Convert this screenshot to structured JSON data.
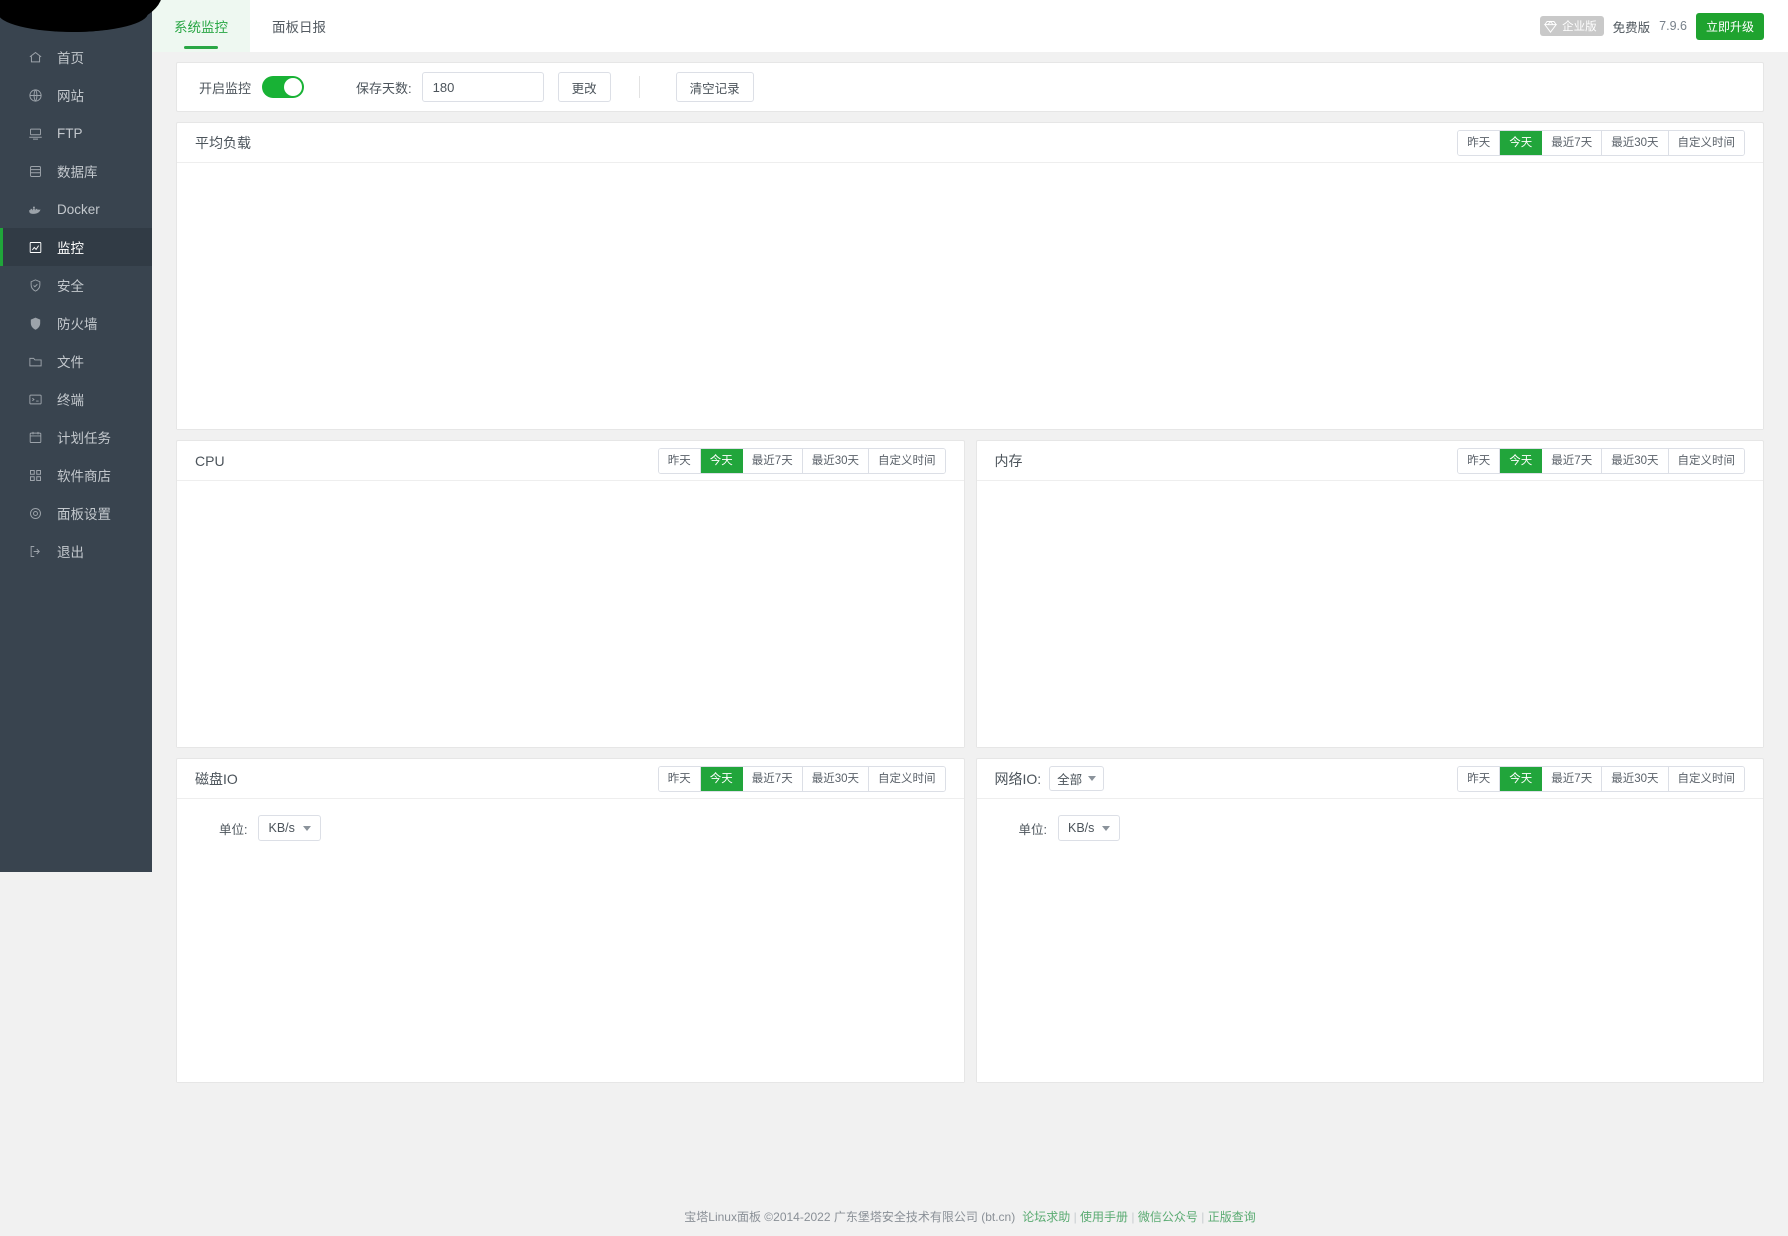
{
  "sidebar": {
    "items": [
      {
        "label": "首页",
        "icon": "home-icon",
        "active": false
      },
      {
        "label": "网站",
        "icon": "globe-icon",
        "active": false
      },
      {
        "label": "FTP",
        "icon": "ftp-icon",
        "active": false
      },
      {
        "label": "数据库",
        "icon": "database-icon",
        "active": false
      },
      {
        "label": "Docker",
        "icon": "docker-icon",
        "active": false
      },
      {
        "label": "监控",
        "icon": "monitor-icon",
        "active": true
      },
      {
        "label": "安全",
        "icon": "shield-check-icon",
        "active": false
      },
      {
        "label": "防火墙",
        "icon": "shield-solid-icon",
        "active": false
      },
      {
        "label": "文件",
        "icon": "folder-icon",
        "active": false
      },
      {
        "label": "终端",
        "icon": "terminal-icon",
        "active": false
      },
      {
        "label": "计划任务",
        "icon": "calendar-icon",
        "active": false
      },
      {
        "label": "软件商店",
        "icon": "grid-icon",
        "active": false
      },
      {
        "label": "面板设置",
        "icon": "gear-icon",
        "active": false
      },
      {
        "label": "退出",
        "icon": "logout-icon",
        "active": false
      }
    ]
  },
  "header": {
    "tabs": [
      {
        "label": "系统监控",
        "active": true
      },
      {
        "label": "面板日报",
        "active": false
      }
    ],
    "enterprise_badge": "企业版",
    "edition": "免费版",
    "version": "7.9.6",
    "upgrade_label": "立即升级"
  },
  "controls": {
    "monitor_toggle_label": "开启监控",
    "monitor_enabled": true,
    "save_days_label": "保存天数:",
    "save_days_value": "180",
    "save_days_placeholder": "保存天数",
    "change_label": "更改",
    "clear_records_label": "清空记录"
  },
  "range_buttons": [
    "昨天",
    "今天",
    "最近7天",
    "最近30天",
    "自定义时间"
  ],
  "active_range": "今天",
  "panels": {
    "load": {
      "title": "平均负载"
    },
    "cpu": {
      "title": "CPU"
    },
    "memory": {
      "title": "内存"
    },
    "disk_io": {
      "title": "磁盘IO",
      "unit_label": "单位:",
      "unit_value": "KB/s"
    },
    "network_io": {
      "title": "网络IO:",
      "interface_value": "全部",
      "unit_label": "单位:",
      "unit_value": "KB/s"
    }
  },
  "footer": {
    "copyright": "宝塔Linux面板 ©2014-2022 广东堡塔安全技术有限公司 (bt.cn)",
    "links": [
      "论坛求助",
      "使用手册",
      "微信公众号",
      "正版查询"
    ],
    "divider": "|"
  },
  "colors": {
    "accent_green": "#21a53b",
    "sidebar_bg": "#39444f",
    "sidebar_active_bg": "#313b45",
    "page_bg": "#f1f1f1"
  },
  "chart_data": [
    {
      "type": "line",
      "title": "平均负载",
      "series": [],
      "x": [],
      "note": "empty"
    },
    {
      "type": "line",
      "title": "CPU",
      "series": [],
      "x": [],
      "note": "empty"
    },
    {
      "type": "line",
      "title": "内存",
      "series": [],
      "x": [],
      "note": "empty"
    },
    {
      "type": "line",
      "title": "磁盘IO",
      "series": [],
      "x": [],
      "ylabel": "KB/s",
      "note": "empty"
    },
    {
      "type": "line",
      "title": "网络IO",
      "series": [],
      "x": [],
      "ylabel": "KB/s",
      "note": "empty"
    }
  ]
}
